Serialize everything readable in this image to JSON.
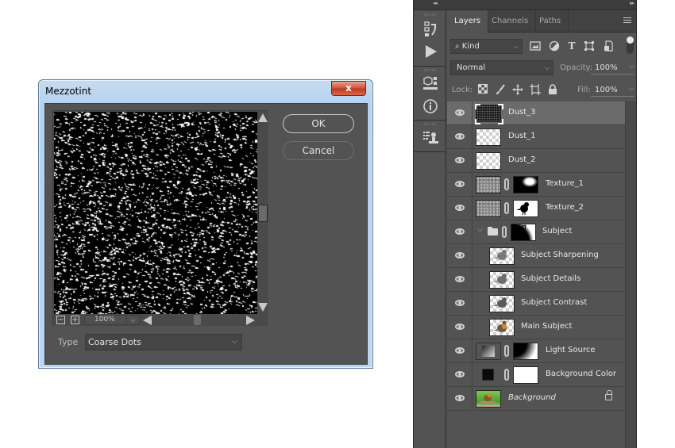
{
  "dialog": {
    "title": "Mezzotint",
    "close_label": "x",
    "ok_label": "OK",
    "cancel_label": "Cancel",
    "zoom_out_label": "−",
    "zoom_in_label": "+",
    "zoom_level": "100%",
    "type_label": "Type",
    "type_value": "Coarse Dots",
    "preview_effect": "mezzotint-coarse-dots"
  },
  "panel": {
    "tabs": [
      {
        "label": "Layers",
        "active": true
      },
      {
        "label": "Channels",
        "active": false
      },
      {
        "label": "Paths",
        "active": false
      }
    ],
    "filter_kind": "Kind",
    "blend_mode": "Normal",
    "opacity_label": "Opacity:",
    "opacity_value": "100%",
    "lock_label": "Lock:",
    "fill_label": "Fill:",
    "fill_value": "100%",
    "layers": [
      {
        "name": "Dust_3",
        "thumb": "dark-noise",
        "mask": null,
        "selected": true,
        "visible": true
      },
      {
        "name": "Dust_1",
        "thumb": "transparent",
        "mask": null,
        "selected": false,
        "visible": true
      },
      {
        "name": "Dust_2",
        "thumb": "transparent",
        "mask": null,
        "selected": false,
        "visible": true
      },
      {
        "name": "Texture_1",
        "thumb": "noise",
        "mask": "light-spot",
        "selected": false,
        "visible": true
      },
      {
        "name": "Texture_2",
        "thumb": "noise",
        "mask": "bird-silhouette",
        "selected": false,
        "visible": true
      },
      {
        "name": "Subject",
        "thumb": "group-folder",
        "mask": "subject-mask",
        "selected": false,
        "visible": true,
        "expanded": true
      },
      {
        "name": "Subject Sharpening",
        "thumb": "bird-gray",
        "mask": null,
        "selected": false,
        "visible": true,
        "indent": true
      },
      {
        "name": "Subject Details",
        "thumb": "bird-gray",
        "mask": null,
        "selected": false,
        "visible": true,
        "indent": true
      },
      {
        "name": "Subject Contrast",
        "thumb": "bird-gray",
        "mask": null,
        "selected": false,
        "visible": true,
        "indent": true
      },
      {
        "name": "Main Subject",
        "thumb": "bird-color",
        "mask": null,
        "selected": false,
        "visible": true,
        "indent": true
      },
      {
        "name": "Light Source",
        "thumb": "gradient",
        "mask": "light-gradient",
        "selected": false,
        "visible": true
      },
      {
        "name": "Background Color",
        "thumb": "black-fill",
        "mask": "white",
        "selected": false,
        "visible": true
      },
      {
        "name": "Background",
        "thumb": "photo",
        "mask": null,
        "selected": false,
        "visible": true,
        "locked": true,
        "italic": true
      }
    ]
  },
  "dock_icons": [
    "history-icon",
    "actions-play-icon",
    "3d-icon",
    "info-icon",
    "properties-icon"
  ],
  "colors": {
    "panel_bg": "#535353",
    "selected_layer": "#6b6b6b",
    "dialog_chrome": "#bcd6f0",
    "close_button": "#c94f38"
  }
}
